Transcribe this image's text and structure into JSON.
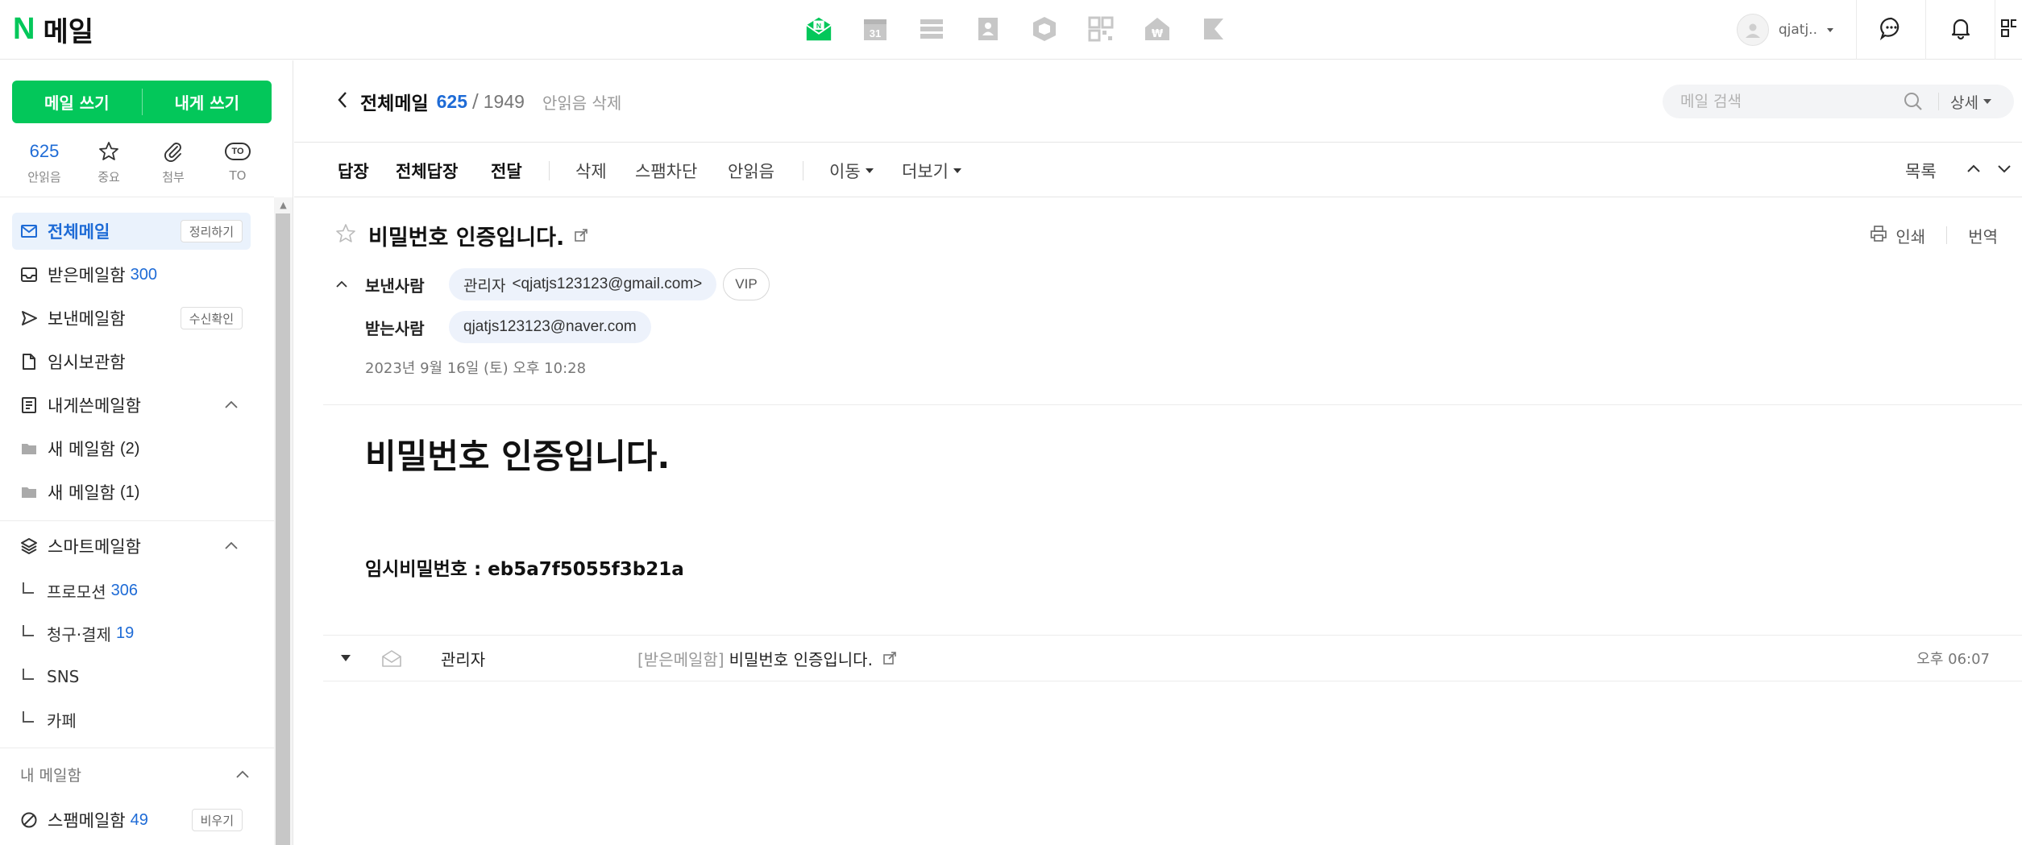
{
  "brand": {
    "logo_letter": "N",
    "logo_text": "메일"
  },
  "topbar": {
    "apps": [
      {
        "name": "mail-app-icon",
        "active": true
      },
      {
        "name": "calendar-app-icon",
        "label": "31"
      },
      {
        "name": "list-app-icon"
      },
      {
        "name": "contacts-app-icon"
      },
      {
        "name": "box-app-icon"
      },
      {
        "name": "qr-app-icon"
      },
      {
        "name": "pay-app-icon"
      },
      {
        "name": "bookmark-app-icon"
      }
    ],
    "username": "qjatj.."
  },
  "sidebar": {
    "compose_label": "메일 쓰기",
    "self_compose_label": "내게 쓰기",
    "quick": {
      "unread_count": "625",
      "unread_label": "안읽음",
      "important_label": "중요",
      "attach_label": "첨부",
      "to_badge": "TO",
      "to_label": "TO"
    },
    "folders": {
      "all": {
        "label": "전체메일",
        "action": "정리하기"
      },
      "inbox": {
        "label": "받은메일함",
        "count": "300"
      },
      "sent": {
        "label": "보낸메일함",
        "action": "수신확인"
      },
      "drafts": {
        "label": "임시보관함"
      },
      "self": {
        "label": "내게쓴메일함"
      },
      "new1": {
        "label": "새 메일함",
        "count": "(2)"
      },
      "new2": {
        "label": "새 메일함",
        "count": "(1)"
      },
      "smart": {
        "label": "스마트메일함"
      },
      "promo": {
        "label": "프로모션",
        "count": "306"
      },
      "billing": {
        "label": "청구·결제",
        "count": "19"
      },
      "sns": {
        "label": "SNS"
      },
      "cafe": {
        "label": "카페"
      },
      "my_group": {
        "label": "내 메일함"
      },
      "spam": {
        "label": "스팸메일함",
        "count": "49",
        "action": "비우기"
      }
    }
  },
  "header": {
    "title": "전체메일",
    "unread": "625",
    "separator": "/",
    "total": "1949",
    "delete_unread": "안읽음 삭제",
    "search_placeholder": "메일 검색",
    "detail_label": "상세"
  },
  "toolbar": {
    "reply": "답장",
    "reply_all": "전체답장",
    "forward": "전달",
    "delete": "삭제",
    "spam": "스팸차단",
    "unread": "안읽음",
    "move": "이동",
    "more": "더보기",
    "list": "목록"
  },
  "message": {
    "subject": "비밀번호 인증입니다.",
    "print": "인쇄",
    "translate": "번역",
    "from_label": "보낸사람",
    "from_name": "관리자",
    "from_email": "<qjatjs123123@gmail.com>",
    "vip": "VIP",
    "to_label": "받는사람",
    "to_email": "qjatjs123123@naver.com",
    "date": "2023년 9월 16일 (토) 오후 10:28",
    "body_heading": "비밀번호 인증입니다.",
    "body_text": "임시비밀번호 : eb5a7f5055f3b21a"
  },
  "thread": {
    "sender": "관리자",
    "folder": "[받은메일함]",
    "subject": "비밀번호 인증입니다.",
    "time": "오후 06:07"
  },
  "colors": {
    "brand_green": "#03c75a",
    "accent_blue": "#1e6bd6"
  }
}
